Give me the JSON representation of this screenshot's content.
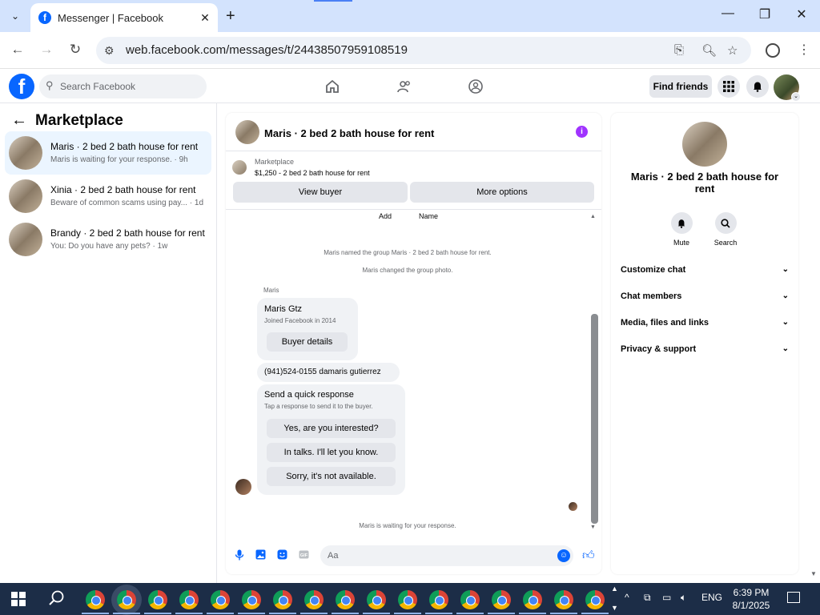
{
  "browser": {
    "tab_title": "Messenger | Facebook",
    "url": "web.facebook.com/messages/t/24438507959108519"
  },
  "fb_header": {
    "search_placeholder": "Search Facebook",
    "find_friends": "Find friends",
    "nav_icons": [
      "home-icon",
      "friends-icon",
      "groups-icon"
    ]
  },
  "left": {
    "title": "Marketplace",
    "conversations": [
      {
        "name": "Maris · 2 bed 2 bath house for rent",
        "preview": "Maris is waiting for your response. · 9h"
      },
      {
        "name": "Xinia · 2 bed 2 bath house for rent",
        "preview": "Beware of common scams using pay... · 1d"
      },
      {
        "name": "Brandy · 2 bed 2 bath house for rent",
        "preview": "You: Do you have any pets? · 1w"
      }
    ]
  },
  "chat": {
    "title": "Maris · 2 bed 2 bath house for rent",
    "listing_label": "Marketplace",
    "listing_price": "$1,250 - 2 bed 2 bath house for rent",
    "view_buyer": "View buyer",
    "more_options": "More options",
    "cap_add": "Add",
    "cap_name": "Name",
    "sys_named": "Maris named the group Maris · 2 bed 2 bath house for rent.",
    "sys_photo": "Maris changed the group photo.",
    "sender": "Maris",
    "card_name": "Maris Gtz",
    "card_joined": "Joined Facebook in 2014",
    "buyer_details": "Buyer details",
    "phone_msg": "(941)524-0155 damaris gutierrez",
    "quick_title": "Send a quick response",
    "quick_sub": "Tap a response to send it to the buyer.",
    "quick_1": "Yes, are you interested?",
    "quick_2": "In talks. I'll let you know.",
    "quick_3": "Sorry, it's not available.",
    "waiting": "Maris is waiting for your response.",
    "composer_placeholder": "Aa"
  },
  "right": {
    "title": "Maris · 2 bed 2 bath house for rent",
    "mute": "Mute",
    "search": "Search",
    "sections": [
      "Customize chat",
      "Chat members",
      "Media, files and links",
      "Privacy & support"
    ]
  },
  "taskbar": {
    "lang": "ENG",
    "time": "6:39 PM",
    "date": "8/1/2025"
  },
  "colors": {
    "facebook_blue": "#0866ff",
    "active_conv": "#ebf5ff",
    "info_purple": "#a033ff",
    "taskbar": "#1c2d47"
  }
}
